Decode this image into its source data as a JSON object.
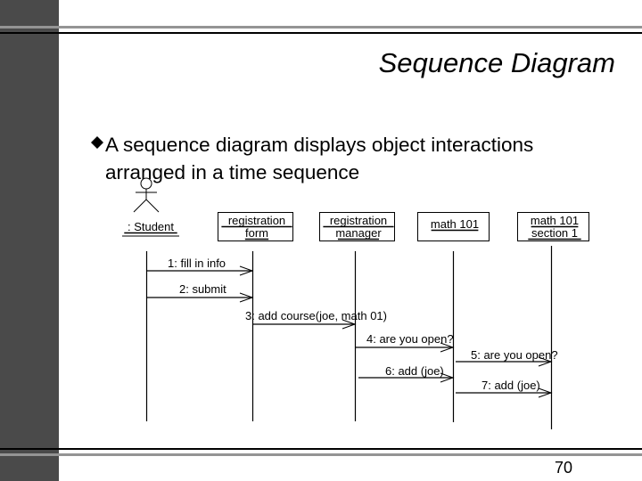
{
  "slide": {
    "title": "Sequence Diagram",
    "bullet_icon": "diamond-bullet-icon",
    "bullet_text": "A sequence diagram displays object interactions arranged in a time sequence",
    "page_number": "70"
  },
  "diagram": {
    "actor_icon": "stick-figure-actor-icon",
    "objects": [
      {
        "id": "student",
        "lines": [
          ": Student"
        ],
        "has_box": false,
        "actor": true
      },
      {
        "id": "registration-form",
        "lines": [
          "registration",
          "form"
        ],
        "has_box": true
      },
      {
        "id": "registration-manager",
        "lines": [
          "registration",
          "manager"
        ],
        "has_box": true
      },
      {
        "id": "math-101",
        "lines": [
          "math 101"
        ],
        "has_box": true
      },
      {
        "id": "math-101-section-1",
        "lines": [
          "math 101",
          "section 1"
        ],
        "has_box": true
      }
    ],
    "messages": [
      {
        "label": "1: fill in info",
        "from": 0,
        "to": 1
      },
      {
        "label": "2: submit",
        "from": 0,
        "to": 1
      },
      {
        "label": "3: add course(joe, math 01)",
        "from": 1,
        "to": 2
      },
      {
        "label": "4: are you open?",
        "from": 2,
        "to": 3
      },
      {
        "label": "5: are you open?",
        "from": 3,
        "to": 4
      },
      {
        "label": "6: add (joe)",
        "from": 2,
        "to": 3
      },
      {
        "label": "7: add (joe)",
        "from": 3,
        "to": 4
      }
    ]
  }
}
